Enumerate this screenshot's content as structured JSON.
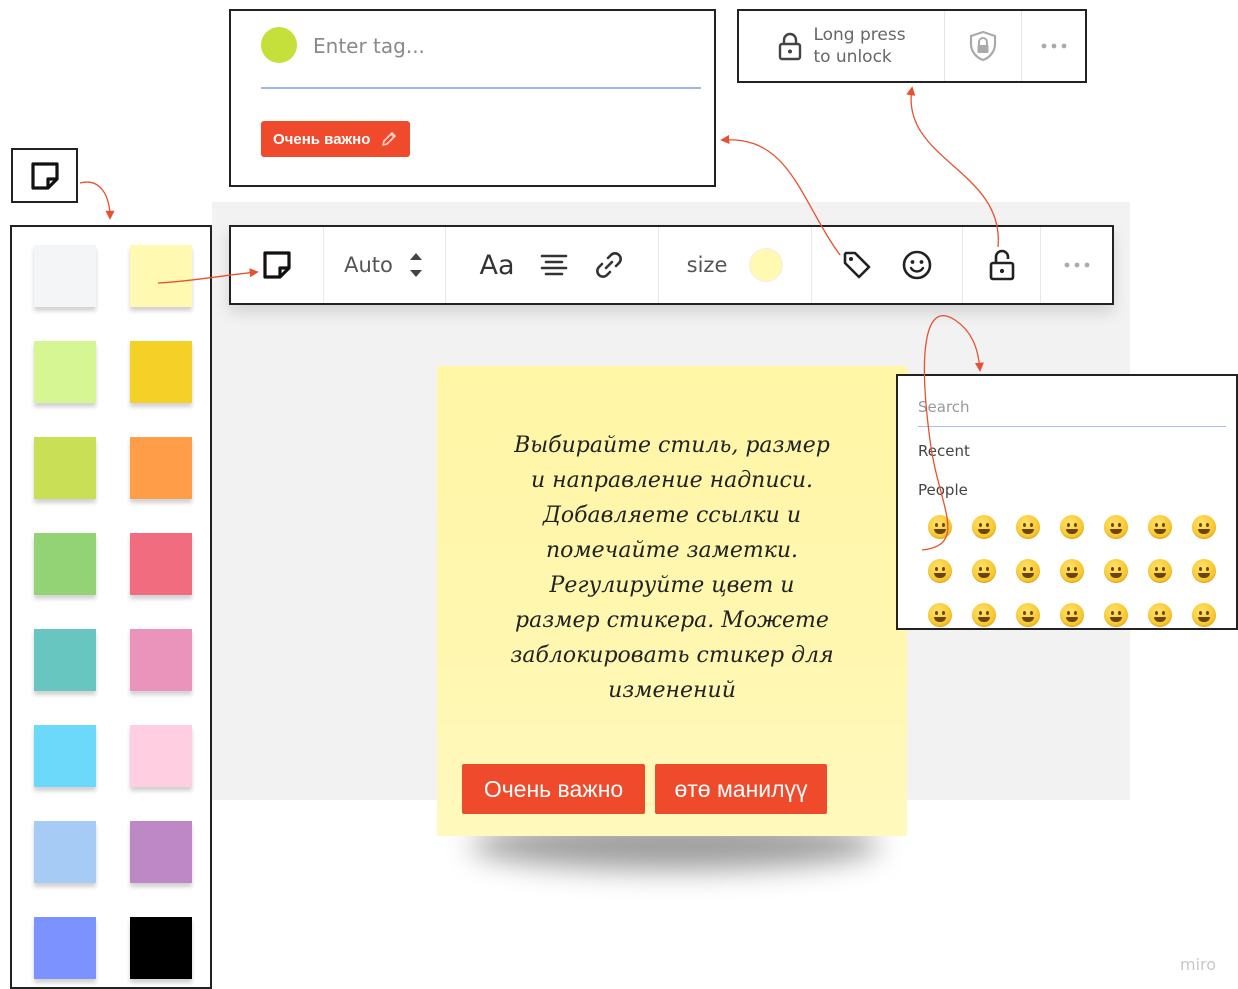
{
  "tag_panel": {
    "placeholder": "Enter tag...",
    "chip_label": "Очень важно",
    "dot_color": "#c5e03a",
    "chip_color": "#ef4a2b",
    "chip_icon": "pencil-icon"
  },
  "lock_panel": {
    "icon": "lock-icon",
    "text_line1": "Long press",
    "text_line2": "to unlock",
    "shield_icon": "shield-lock-icon",
    "more_icon": "more-horizontal-icon"
  },
  "sticker_icon": "sticky-note-icon",
  "palette": {
    "colors": [
      "#f4f5f7",
      "#fff9b1",
      "#d5f692",
      "#f5d128",
      "#c9df56",
      "#ff9d48",
      "#93d275",
      "#f16c7f",
      "#67c6c0",
      "#ea94bb",
      "#6cd8fa",
      "#ffcee0",
      "#a6ccf5",
      "#be88c7",
      "#7b92ff",
      "#000000"
    ]
  },
  "toolbar": {
    "sticker_icon": "sticky-note-icon",
    "auto_label": "Auto",
    "updown_icon": "chevron-up-down-icon",
    "font_label": "Aa",
    "align_icon": "align-center-icon",
    "link_icon": "link-icon",
    "size_label": "size",
    "size_color": "#fff9b1",
    "tag_icon": "tag-icon",
    "emoji_icon": "smiley-icon",
    "unlock_icon": "unlock-icon",
    "more_icon": "more-horizontal-icon"
  },
  "note": {
    "lines": [
      "Выбирайте стиль, размер",
      "и направление надписи.",
      "Добавляете ссылки и",
      "помечайте заметки.",
      "Регулируйте цвет и",
      "размер стикера. Можете",
      "заблокировать стикер для",
      "изменений"
    ],
    "tag1": "Очень важно",
    "tag2": "өтө манилүү",
    "color": "#fff9b1"
  },
  "emoji_picker": {
    "placeholder": "Search",
    "recent_label": "Recent",
    "people_label": "People",
    "rows": 3,
    "per_row": 7
  },
  "watermark": "miro"
}
